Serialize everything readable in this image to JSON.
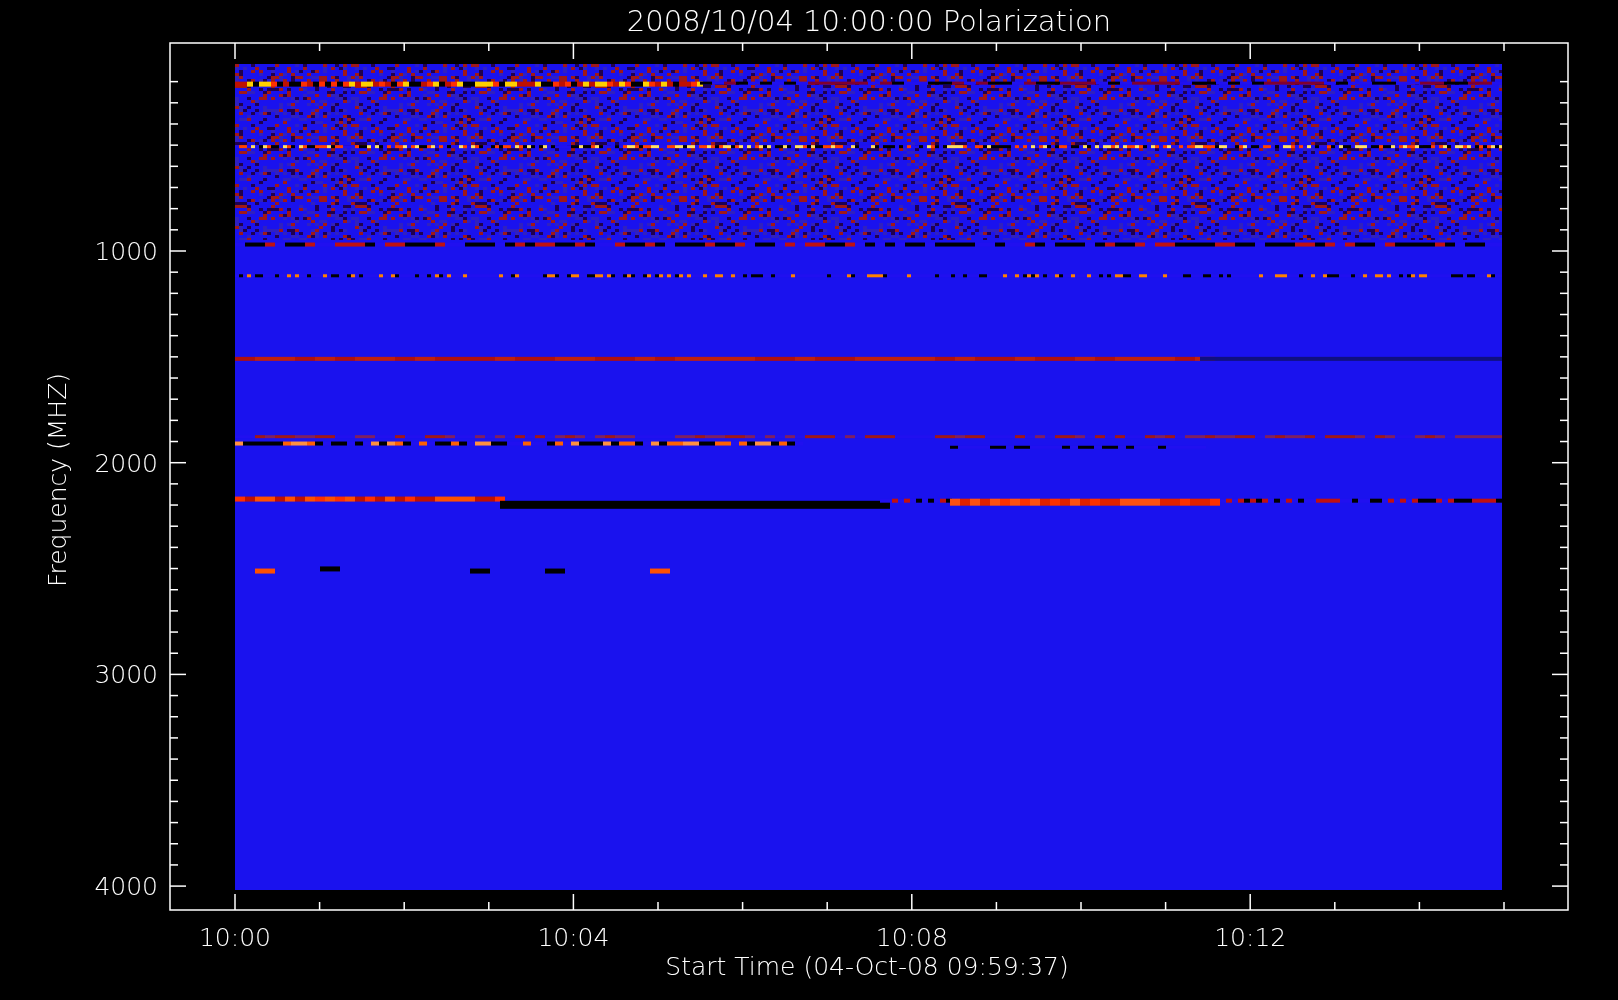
{
  "plot": {
    "title": "2008/10/04 10:00:00 Polarization",
    "ylabel": "Frequency (MHZ)",
    "xlabel": "Start Time (04-Oct-08 09:59:37)",
    "yticks": [
      "1000",
      "2000",
      "3000",
      "4000"
    ],
    "xticks": [
      "10:00",
      "10:04",
      "10:08",
      "10:12"
    ]
  }
}
